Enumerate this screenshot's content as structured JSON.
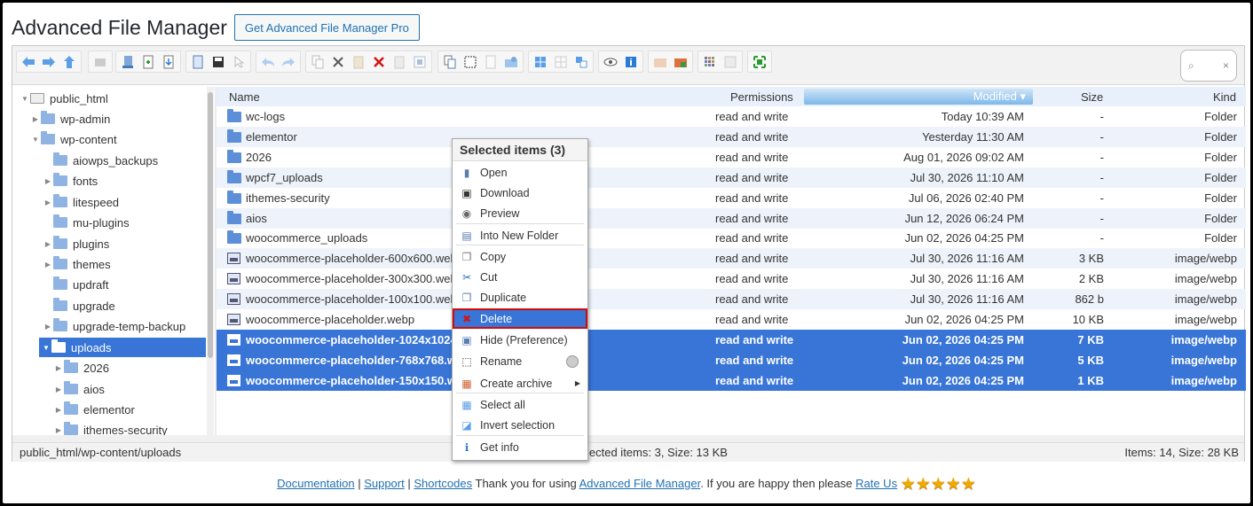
{
  "header": {
    "title": "Advanced File Manager",
    "pro_button": "Get Advanced File Manager Pro"
  },
  "toolbar": {
    "search_icon": "search-icon",
    "clear_icon": "×"
  },
  "tree": {
    "root": "public_html",
    "items": [
      {
        "label": "wp-admin"
      },
      {
        "label": "wp-content"
      },
      {
        "label": "aiowps_backups"
      },
      {
        "label": "fonts"
      },
      {
        "label": "litespeed"
      },
      {
        "label": "mu-plugins"
      },
      {
        "label": "plugins"
      },
      {
        "label": "themes"
      },
      {
        "label": "updraft"
      },
      {
        "label": "upgrade"
      },
      {
        "label": "upgrade-temp-backup"
      },
      {
        "label": "uploads"
      },
      {
        "label": "2026"
      },
      {
        "label": "aios"
      },
      {
        "label": "elementor"
      },
      {
        "label": "ithemes-security"
      }
    ]
  },
  "columns": {
    "name": "Name",
    "permissions": "Permissions",
    "modified": "Modified",
    "size": "Size",
    "kind": "Kind"
  },
  "files": [
    {
      "name": "wc-logs",
      "perm": "read and write",
      "modified": "Today 10:39 AM",
      "size": "-",
      "kind": "Folder"
    },
    {
      "name": "elementor",
      "perm": "read and write",
      "modified": "Yesterday 11:30 AM",
      "size": "-",
      "kind": "Folder"
    },
    {
      "name": "2026",
      "perm": "read and write",
      "modified": "Aug 01, 2026 09:02 AM",
      "size": "-",
      "kind": "Folder"
    },
    {
      "name": "wpcf7_uploads",
      "perm": "read and write",
      "modified": "Jul 30, 2026 11:10 AM",
      "size": "-",
      "kind": "Folder"
    },
    {
      "name": "ithemes-security",
      "perm": "read and write",
      "modified": "Jul 06, 2026 02:40 PM",
      "size": "-",
      "kind": "Folder"
    },
    {
      "name": "aios",
      "perm": "read and write",
      "modified": "Jun 12, 2026 06:24 PM",
      "size": "-",
      "kind": "Folder"
    },
    {
      "name": "woocommerce_uploads",
      "perm": "read and write",
      "modified": "Jun 02, 2026 04:25 PM",
      "size": "-",
      "kind": "Folder"
    },
    {
      "name": "woocommerce-placeholder-600x600.webp",
      "perm": "read and write",
      "modified": "Jul 30, 2026 11:16 AM",
      "size": "3 KB",
      "kind": "image/webp"
    },
    {
      "name": "woocommerce-placeholder-300x300.webp",
      "perm": "read and write",
      "modified": "Jul 30, 2026 11:16 AM",
      "size": "2 KB",
      "kind": "image/webp"
    },
    {
      "name": "woocommerce-placeholder-100x100.webp",
      "perm": "read and write",
      "modified": "Jul 30, 2026 11:16 AM",
      "size": "862 b",
      "kind": "image/webp"
    },
    {
      "name": "woocommerce-placeholder.webp",
      "perm": "read and write",
      "modified": "Jun 02, 2026 04:25 PM",
      "size": "10 KB",
      "kind": "image/webp"
    },
    {
      "name": "woocommerce-placeholder-1024x1024.webp",
      "perm": "read and write",
      "modified": "Jun 02, 2026 04:25 PM",
      "size": "7 KB",
      "kind": "image/webp"
    },
    {
      "name": "woocommerce-placeholder-768x768.webp",
      "perm": "read and write",
      "modified": "Jun 02, 2026 04:25 PM",
      "size": "5 KB",
      "kind": "image/webp"
    },
    {
      "name": "woocommerce-placeholder-150x150.webp",
      "perm": "read and write",
      "modified": "Jun 02, 2026 04:25 PM",
      "size": "1 KB",
      "kind": "image/webp"
    }
  ],
  "status": {
    "path": "public_html/wp-content/uploads",
    "selected": "lected items: 3, Size: 13 KB",
    "items": "Items: 14, Size: 28 KB"
  },
  "context_menu": {
    "title": "Selected items (3)",
    "items": [
      {
        "label": "Open",
        "icon": "open-icon"
      },
      {
        "label": "Download",
        "icon": "download-icon"
      },
      {
        "label": "Preview",
        "icon": "preview-icon"
      },
      {
        "label": "Into New Folder",
        "icon": "new-folder-icon"
      },
      {
        "label": "Copy",
        "icon": "copy-icon"
      },
      {
        "label": "Cut",
        "icon": "cut-icon"
      },
      {
        "label": "Duplicate",
        "icon": "duplicate-icon"
      },
      {
        "label": "Delete",
        "icon": "delete-icon"
      },
      {
        "label": "Hide (Preference)",
        "icon": "hide-icon"
      },
      {
        "label": "Rename",
        "icon": "rename-icon"
      },
      {
        "label": "Create archive",
        "icon": "archive-icon"
      },
      {
        "label": "Select all",
        "icon": "select-all-icon"
      },
      {
        "label": "Invert selection",
        "icon": "invert-selection-icon"
      },
      {
        "label": "Get info",
        "icon": "info-icon"
      }
    ]
  },
  "footer": {
    "documentation": "Documentation",
    "support": "Support",
    "shortcodes": "Shortcodes",
    "text1": "Thank you for using",
    "afm_link": "Advanced File Manager",
    "text2": ". If you are happy then please",
    "rate_us": "Rate Us",
    "stars": "★★★★★"
  },
  "colors": {
    "selection": "#3875d7",
    "accent": "#2271b1",
    "delete_outline": "#d10b0b"
  }
}
